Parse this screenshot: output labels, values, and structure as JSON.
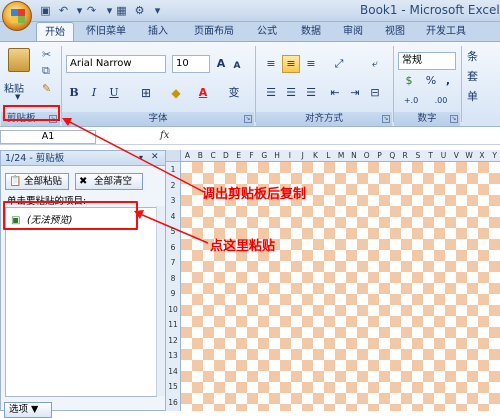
{
  "window": {
    "title": "Book1 - Microsoft Excel"
  },
  "qat": {
    "icons": [
      "save-icon",
      "undo-icon",
      "redo-icon",
      "table-icon",
      "settings-icon",
      "customize-icon"
    ]
  },
  "tabs": [
    "开始",
    "怀旧菜单",
    "插入",
    "页面布局",
    "公式",
    "数据",
    "审阅",
    "视图",
    "开发工具"
  ],
  "ribbon": {
    "clipboard": {
      "label": "剪贴板",
      "paste": "粘贴"
    },
    "font": {
      "label": "字体",
      "name": "Arial Narrow",
      "size": "10",
      "grow": "A",
      "shrink": "A",
      "bold": "B",
      "italic": "I",
      "underline": "U",
      "wen": "变"
    },
    "alignment": {
      "label": "对齐方式"
    },
    "number": {
      "label": "数字",
      "format": "常规",
      "pct": "%",
      "comma": ",",
      "inc": "+.0",
      "dec": ".00"
    },
    "styles": {
      "a": "条",
      "b": "套",
      "c": "单"
    }
  },
  "formula_bar": {
    "name_box": "A1",
    "fx": "fx"
  },
  "clipboard_pane": {
    "title": "1/24 - 剪贴板",
    "paste_all": "全部粘贴",
    "clear_all": "全部清空",
    "hint": "单击要粘贴的项目:",
    "item": "(无法预览)",
    "options": "选项 ▼"
  },
  "sheet": {
    "columns": [
      "A",
      "B",
      "C",
      "D",
      "E",
      "F",
      "G",
      "H",
      "I",
      "J",
      "K",
      "L",
      "M",
      "N",
      "O",
      "P",
      "Q",
      "R",
      "S",
      "T",
      "U",
      "V",
      "W",
      "X",
      "Y"
    ],
    "rows": [
      "1",
      "2",
      "3",
      "4",
      "5",
      "6",
      "7",
      "8",
      "9",
      "10",
      "11",
      "12",
      "13",
      "14",
      "15",
      "16"
    ]
  },
  "annotations": {
    "a": "调出剪贴板后复制",
    "b": "点这里粘贴"
  },
  "colors": {
    "accent": "#e11",
    "ribbon": "#d6e4f5",
    "checker": "#f3c8a6"
  }
}
